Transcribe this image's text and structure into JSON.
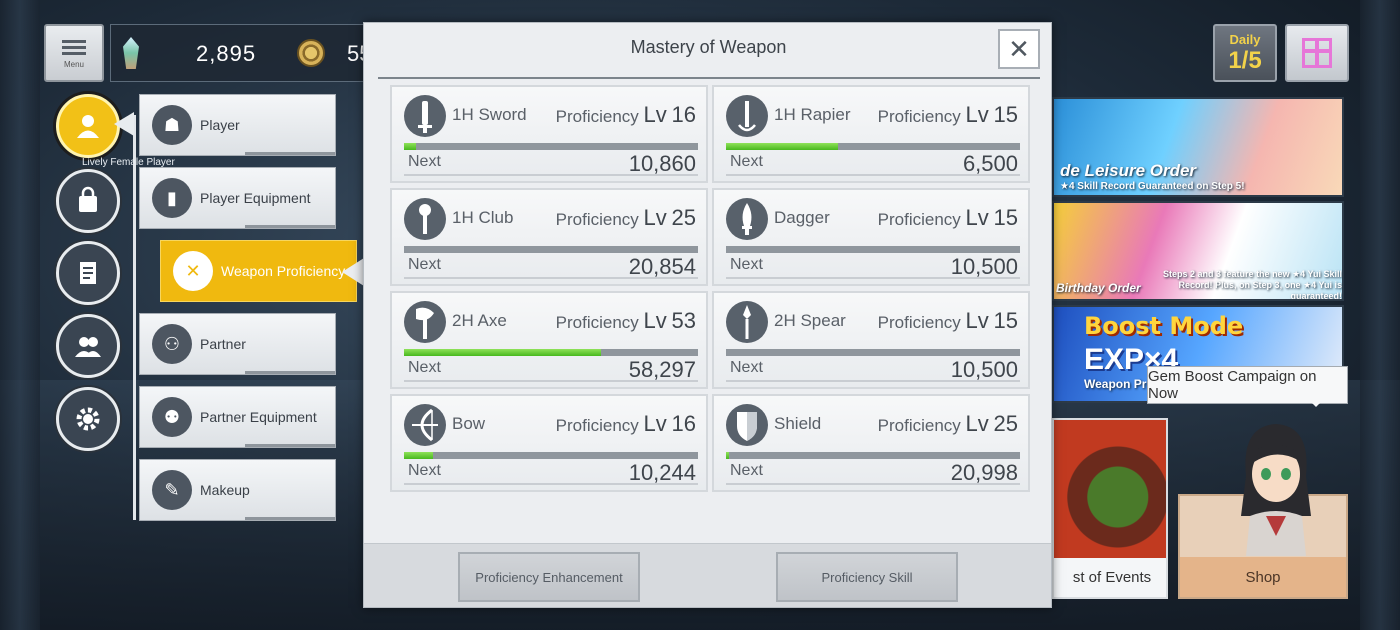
{
  "topbar": {
    "menu_label": "Menu",
    "crystals": "2,895",
    "coins": "55"
  },
  "daily": {
    "title": "Daily",
    "value": "1/5"
  },
  "player": {
    "name": "Lively Female Player"
  },
  "submenu": [
    {
      "label": "Player"
    },
    {
      "label": "Player Equipment"
    },
    {
      "label": "Weapon Proficiency"
    },
    {
      "label": "Partner"
    },
    {
      "label": "Partner Equipment"
    },
    {
      "label": "Makeup"
    }
  ],
  "modal": {
    "title": "Mastery of Weapon",
    "close_symbol": "✕",
    "prof_label": "Proficiency",
    "lv_label": "Lv",
    "next_label": "Next",
    "weapons": [
      {
        "name": "1H Sword",
        "level": "16",
        "next": "10,860",
        "progress": 0.04,
        "icon": "sword-icon"
      },
      {
        "name": "1H Rapier",
        "level": "15",
        "next": "6,500",
        "progress": 0.38,
        "icon": "rapier-icon"
      },
      {
        "name": "1H Club",
        "level": "25",
        "next": "20,854",
        "progress": 0.0,
        "icon": "club-icon"
      },
      {
        "name": "Dagger",
        "level": "15",
        "next": "10,500",
        "progress": 0.0,
        "icon": "dagger-icon"
      },
      {
        "name": "2H Axe",
        "level": "53",
        "next": "58,297",
        "progress": 0.67,
        "icon": "axe-icon"
      },
      {
        "name": "2H Spear",
        "level": "15",
        "next": "10,500",
        "progress": 0.0,
        "icon": "spear-icon"
      },
      {
        "name": "Bow",
        "level": "16",
        "next": "10,244",
        "progress": 0.1,
        "icon": "bow-icon"
      },
      {
        "name": "Shield",
        "level": "25",
        "next": "20,998",
        "progress": 0.01,
        "icon": "shield-icon"
      }
    ],
    "footer": {
      "enhance_label": "Proficiency Enhancement",
      "skill_label": "Proficiency Skill"
    }
  },
  "banners": {
    "b1_text": "de Leisure Order",
    "b1_sub": "★4 Skill Record Guaranteed on Step 5!",
    "b2_text": "Birthday Order",
    "b2_sub": "Steps 2 and 3 feature the new ★4 Yui Skill Record! Plus, on Step 3, one ★4 Yui is guaranteed!",
    "b3_title": "Boost Mode",
    "b3_exp": "EXP×4",
    "b3_sub": "Weapon Pro"
  },
  "tooltip": "Gem Boost Campaign on Now",
  "events_label": "st of Events",
  "shop_label": "Shop"
}
